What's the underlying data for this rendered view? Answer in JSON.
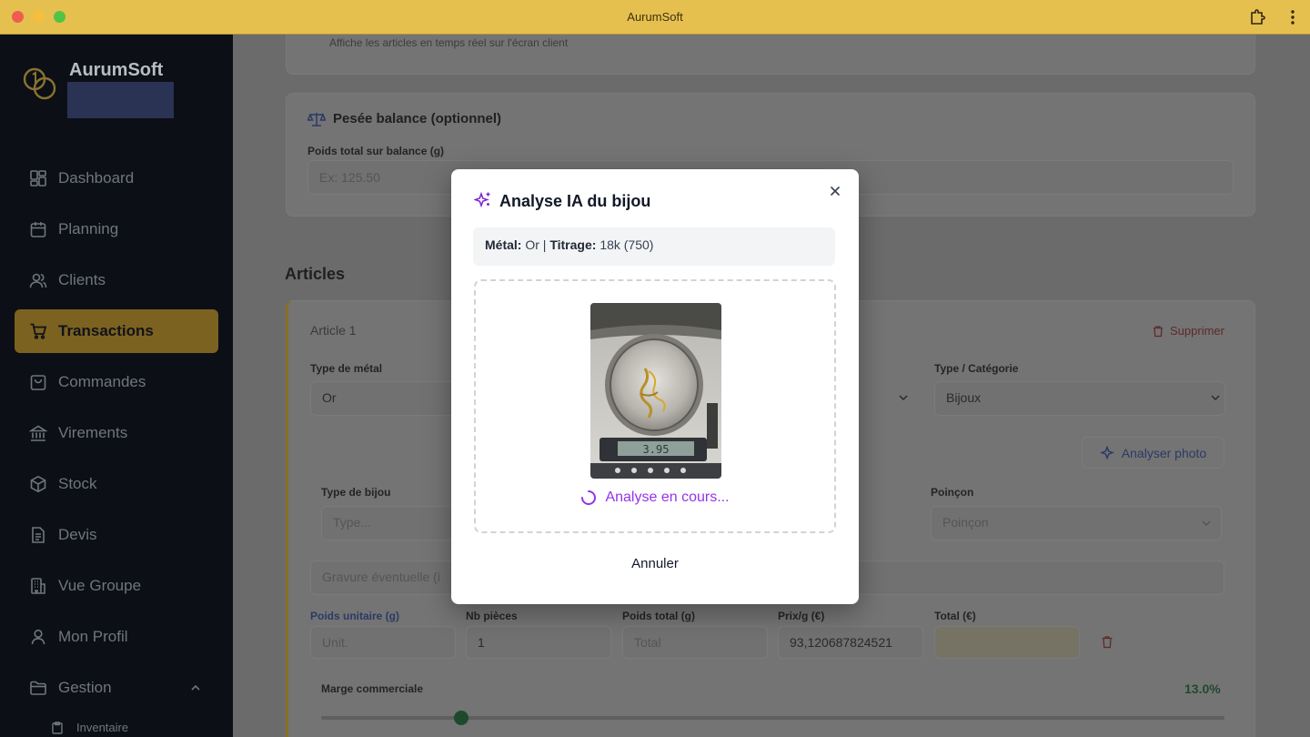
{
  "window": {
    "title": "AurumSoft"
  },
  "sidebar": {
    "brand": "AurumSoft",
    "items": [
      {
        "label": "Dashboard",
        "icon": "dashboard-icon"
      },
      {
        "label": "Planning",
        "icon": "calendar-icon"
      },
      {
        "label": "Clients",
        "icon": "users-icon"
      },
      {
        "label": "Transactions",
        "icon": "cart-icon",
        "active": true
      },
      {
        "label": "Commandes",
        "icon": "shopping-bag-icon"
      },
      {
        "label": "Virements",
        "icon": "bank-icon"
      },
      {
        "label": "Stock",
        "icon": "box-icon"
      },
      {
        "label": "Devis",
        "icon": "file-icon"
      },
      {
        "label": "Vue Groupe",
        "icon": "building-icon"
      },
      {
        "label": "Mon Profil",
        "icon": "user-icon"
      },
      {
        "label": "Gestion",
        "icon": "folder-icon"
      }
    ],
    "sub_item": "Inventaire"
  },
  "main": {
    "display_desc": "Affiche les articles en temps réel sur l'écran client",
    "scale": {
      "title": "Pesée balance (optionnel)",
      "weight_label": "Poids total sur balance (g)",
      "weight_placeholder": "Ex: 125.50"
    },
    "articles_heading": "Articles",
    "article": {
      "title": "Article 1",
      "delete_label": "Supprimer",
      "metal_type_label": "Type de métal",
      "metal_type_value": "Or",
      "category_label": "Type / Catégorie",
      "category_value": "Bijoux",
      "analyze_photo_label": "Analyser photo",
      "jewel_type_label": "Type de bijou",
      "jewel_type_placeholder": "Type...",
      "hallmark_label": "Poinçon",
      "hallmark_placeholder": "Poinçon",
      "engraving_placeholder": "Gravure éventuelle (i",
      "unit_weight_label": "Poids unitaire (g)",
      "unit_weight_placeholder": "Unit.",
      "pieces_label": "Nb pièces",
      "pieces_value": "1",
      "total_weight_label": "Poids total (g)",
      "total_weight_placeholder": "Total",
      "price_label": "Prix/g (€)",
      "price_value": "93,120687824521",
      "total_label": "Total (€)",
      "margin_label": "Marge commerciale",
      "margin_value": "13.0%"
    }
  },
  "modal": {
    "title": "Analyse IA du bijou",
    "metal_label": "Métal:",
    "metal_value": "Or",
    "separator": "|",
    "titrage_label": "Titrage:",
    "titrage_value": "18k (750)",
    "status": "Analyse en cours...",
    "photo_alt": "Chaîne en or sur balance",
    "scale_reading": "3.95",
    "cancel_label": "Annuler"
  },
  "colors": {
    "accent": "#e6c04f",
    "sidebar_bg": "#0c0f16",
    "active_nav": "#7c6220",
    "purple": "#9333ea",
    "delete_red": "#b91c1c",
    "margin_green": "#15803d"
  }
}
